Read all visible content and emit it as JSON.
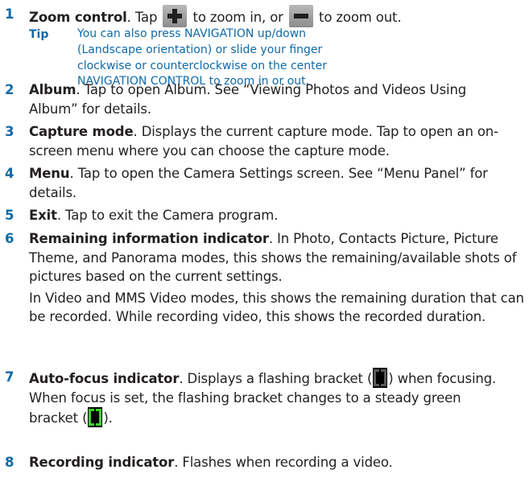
{
  "items": [
    {
      "num": "1",
      "title": "Zoom control",
      "t1": ". Tap ",
      "t2": " to zoom in, or ",
      "t3": " to zoom out."
    },
    {
      "num": "2",
      "title": "Album",
      "text": ". Tap to open Album. See “Viewing Photos and Videos Using Album” for details."
    },
    {
      "num": "3",
      "title": "Capture mode",
      "text": ". Displays the current capture mode. Tap to open an on-screen menu where you can choose the capture mode."
    },
    {
      "num": "4",
      "title": "Menu",
      "text": ". Tap to open the Camera Settings screen. See “Menu Panel” for details."
    },
    {
      "num": "5",
      "title": "Exit",
      "text": ". Tap to exit the Camera program."
    },
    {
      "num": "6",
      "title": "Remaining information indicator",
      "text": ". In Photo, Contacts Picture, Picture Theme, and Panorama modes, this shows the remaining/available shots of pictures based on the current settings.",
      "para2": "In Video and MMS Video modes, this shows the remaining duration that can be recorded. While recording video, this shows the recorded duration."
    },
    {
      "num": "7",
      "title": "Auto-focus indicator",
      "t1": ". Displays a flashing bracket (",
      "t2": ") when focusing. When focus is set, the flashing bracket changes to a steady green bracket (",
      "t3": ")."
    },
    {
      "num": "8",
      "title": "Recording indicator",
      "text": ". Flashes when recording a video."
    }
  ],
  "tip": {
    "label": "Tip",
    "text": "You can also press NAVIGATION up/down (Landscape orientation) or slide your finger clockwise or counterclockwise on the center NAVIGATION CONTROL to zoom in or out."
  },
  "icons": {
    "zoom_in": "plus-icon",
    "zoom_out": "minus-icon",
    "flashing_bracket": "flashing-bracket-icon",
    "steady_bracket": "green-bracket-icon"
  },
  "colors": {
    "accent": "#0f6aa8",
    "body_text": "#231f20",
    "focus_green": "#3fd22b"
  }
}
